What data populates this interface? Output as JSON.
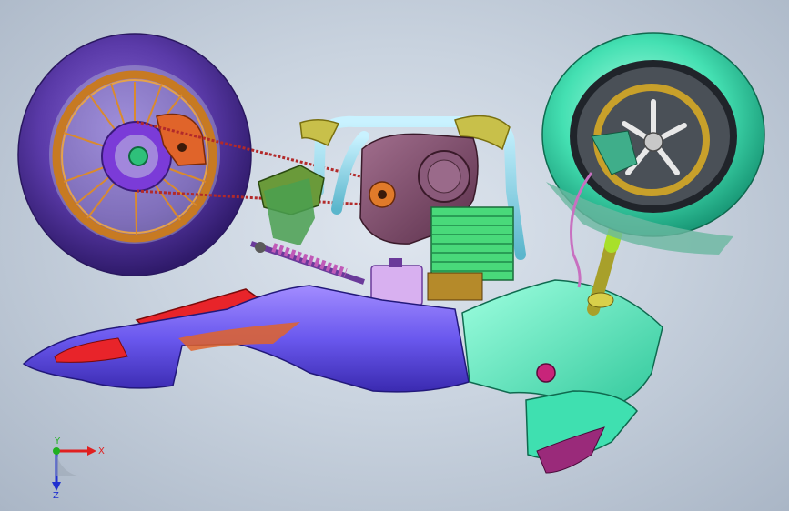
{
  "triad": {
    "x_label": "X",
    "y_label": "Y",
    "z_label": "Z"
  },
  "colors": {
    "background": "#c9d3df",
    "rear_tire": "#4b2a9a",
    "rim": "#c77a22",
    "front_tire": "#3fe0b0",
    "fairing": "#5a4ee8",
    "frame": "#6fc6d8",
    "engine": "#7a4a66",
    "cylinder": "#49d97a",
    "red_part": "#e8242a"
  }
}
